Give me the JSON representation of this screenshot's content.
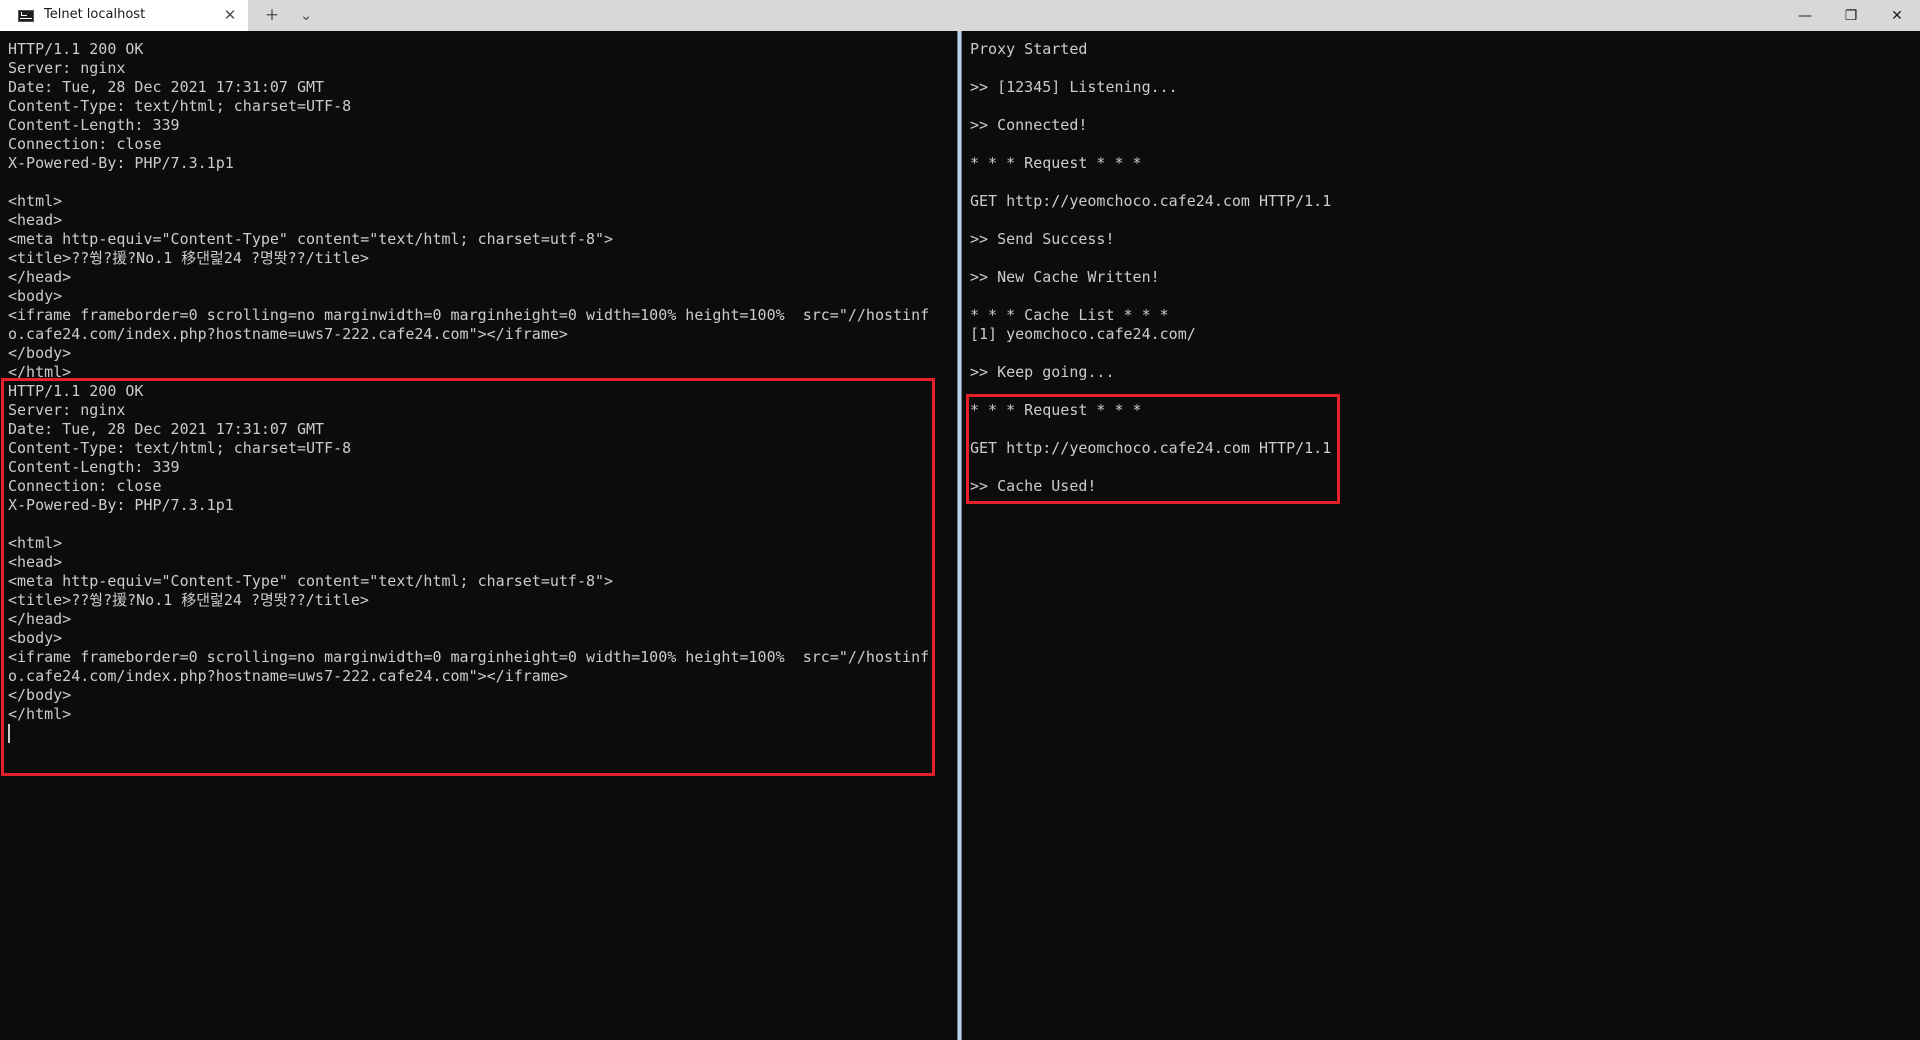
{
  "window": {
    "tab_title": "Telnet localhost",
    "tab_close": "✕",
    "new_tab": "+",
    "tab_menu": "⌄",
    "minimize": "—",
    "restore": "❐",
    "close": "✕"
  },
  "left_pane": {
    "lines": [
      "HTTP/1.1 200 OK",
      "Server: nginx",
      "Date: Tue, 28 Dec 2021 17:31:07 GMT",
      "Content-Type: text/html; charset=UTF-8",
      "Content-Length: 339",
      "Connection: close",
      "X-Powered-By: PHP/7.3.1p1",
      "",
      "<html>",
      "<head>",
      "<meta http-equiv=\"Content-Type\" content=\"text/html; charset=utf-8\">",
      "<title>??쒕?援?No.1 移댄럹24 ?명똿??/title>",
      "</head>",
      "<body>",
      "<iframe frameborder=0 scrolling=no marginwidth=0 marginheight=0 width=100% height=100%  src=\"//hostinf",
      "o.cafe24.com/index.php?hostname=uws7-222.cafe24.com\"></iframe>",
      "</body>",
      "</html>",
      "HTTP/1.1 200 OK",
      "Server: nginx",
      "Date: Tue, 28 Dec 2021 17:31:07 GMT",
      "Content-Type: text/html; charset=UTF-8",
      "Content-Length: 339",
      "Connection: close",
      "X-Powered-By: PHP/7.3.1p1",
      "",
      "<html>",
      "<head>",
      "<meta http-equiv=\"Content-Type\" content=\"text/html; charset=utf-8\">",
      "<title>??쒕?援?No.1 移댄럹24 ?명똿??/title>",
      "</head>",
      "<body>",
      "<iframe frameborder=0 scrolling=no marginwidth=0 marginheight=0 width=100% height=100%  src=\"//hostinf",
      "o.cafe24.com/index.php?hostname=uws7-222.cafe24.com\"></iframe>",
      "</body>",
      "</html>"
    ]
  },
  "right_pane": {
    "lines": [
      "Proxy Started",
      "",
      ">> [12345] Listening...",
      "",
      ">> Connected!",
      "",
      "* * * Request * * *",
      "",
      "GET http://yeomchoco.cafe24.com HTTP/1.1",
      "",
      ">> Send Success!",
      "",
      ">> New Cache Written!",
      "",
      "* * * Cache List * * *",
      "[1] yeomchoco.cafe24.com/",
      "",
      ">> Keep going...",
      "",
      "* * * Request * * *",
      "",
      "GET http://yeomchoco.cafe24.com HTTP/1.1",
      "",
      ">> Cache Used!"
    ]
  },
  "colors": {
    "terminal_bg": "#0c0c0c",
    "terminal_text": "#cccccc",
    "highlight": "#e8202a",
    "titlebar": "#d8d8d8"
  }
}
